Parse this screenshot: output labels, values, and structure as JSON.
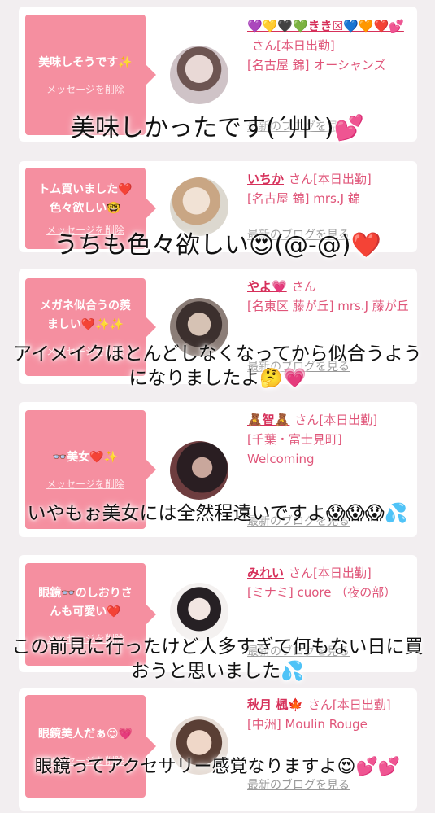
{
  "cards": [
    {
      "message": "美味しそうです✨",
      "delete_label": "メッセージを削除",
      "name": "💜💛🖤💚きき☒💙🧡❤️💕",
      "honorific": "さん[本日出勤]",
      "shop": "[名古屋 錦] オーシャンズ",
      "blog_label": "最新のブログを見る",
      "caption": "美味しかったです(´艸`)💕"
    },
    {
      "message": "トム買いました❤️色々欲しい🤓",
      "delete_label": "メッセージを削除",
      "name": "いちか",
      "honorific": "さん[本日出勤]",
      "shop": "[名古屋 錦] mrs.J 錦",
      "blog_label": "最新のブログを見る",
      "caption": "うちも色々欲しい😍(@-@)❤️"
    },
    {
      "message": "メガネ似合うの羨ましい❤️✨✨",
      "delete_label": "メッセージを削除",
      "name": "やよ💗",
      "honorific": "さん",
      "shop": "[名東区 藤が丘] mrs.J 藤が丘",
      "blog_label": "最新のブログを見る",
      "caption": "アイメイクほとんどしなくなってから似合うようになりましたよ🤔💗"
    },
    {
      "message": "👓美女❤️✨",
      "delete_label": "メッセージを削除",
      "name": "🧸智🧸",
      "honorific": "さん[本日出勤]",
      "shop": "[千葉・富士見町] Welcoming",
      "blog_label": "最新のブログを見る",
      "caption": "いやもぉ美女には全然程遠いですよ😱😱😱💦"
    },
    {
      "message": "眼鏡👓のしおりさんも可愛い❤️",
      "delete_label": "メッセージを削除",
      "name": "みれい",
      "honorific": "さん[本日出勤]",
      "shop": "[ミナミ] cuore （夜の部）",
      "blog_label": "最新のブログを見る",
      "caption": "この前見に行ったけど人多すぎて何もない日に買おうと思いました💦"
    },
    {
      "message": "眼鏡美人だぁ😍💗",
      "delete_label": "メッセージを削除",
      "name": "秋月 楓🍁",
      "honorific": "さん[本日出勤]",
      "shop": "[中洲] Moulin Rouge",
      "blog_label": "最新のブログを見る",
      "caption": "眼鏡ってアクセサリー感覚なりますよ😍💕💕"
    }
  ],
  "colors": {
    "bubble": "#f58fa0",
    "name": "#d6305a",
    "shop": "#e0567a"
  }
}
